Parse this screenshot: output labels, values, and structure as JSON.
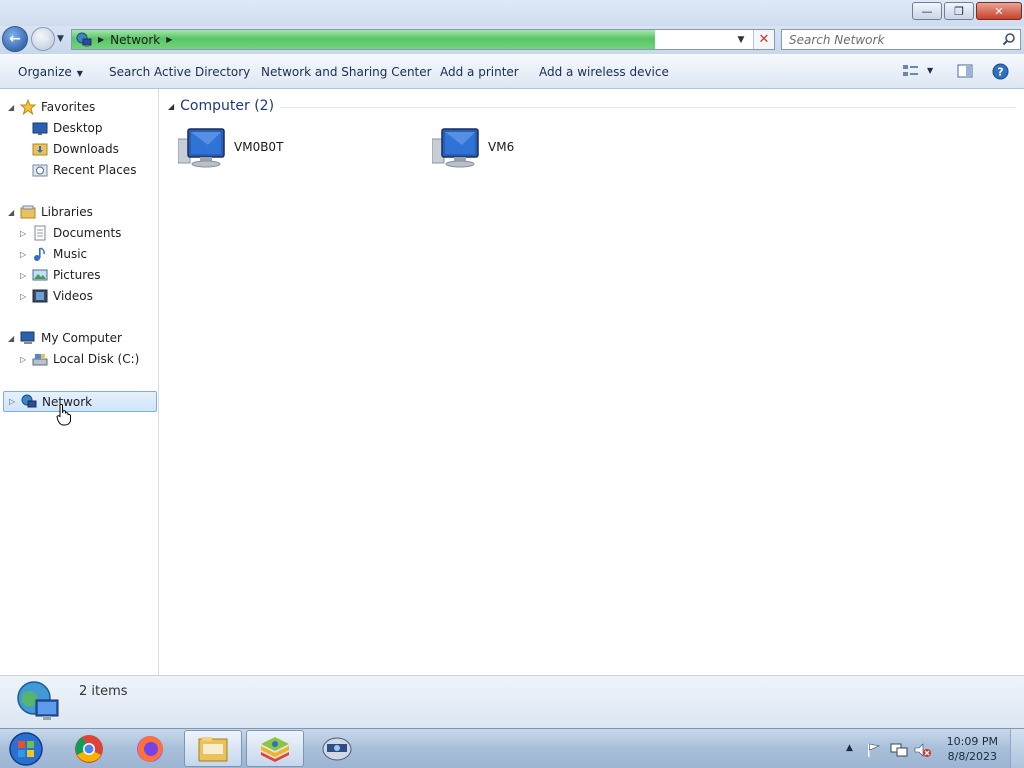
{
  "window": {
    "controls": {
      "minimize": "—",
      "maximize": "❐",
      "close": "✕"
    }
  },
  "nav": {
    "back_glyph": "←",
    "forward_glyph": "→",
    "address": {
      "location": "Network",
      "progress": 0.83
    },
    "search": {
      "placeholder": "Search Network"
    }
  },
  "toolbar": {
    "organize": "Organize",
    "search_ad": "Search Active Directory",
    "network_sharing": "Network and Sharing Center",
    "add_printer": "Add a printer",
    "add_wireless": "Add a wireless device"
  },
  "sidebar": {
    "favorites": {
      "label": "Favorites",
      "items": [
        {
          "label": "Desktop",
          "icon": "desktop-icon"
        },
        {
          "label": "Downloads",
          "icon": "downloads-folder-icon"
        },
        {
          "label": "Recent Places",
          "icon": "recent-places-icon"
        }
      ]
    },
    "libraries": {
      "label": "Libraries",
      "items": [
        {
          "label": "Documents",
          "icon": "documents-icon"
        },
        {
          "label": "Music",
          "icon": "music-icon"
        },
        {
          "label": "Pictures",
          "icon": "pictures-icon"
        },
        {
          "label": "Videos",
          "icon": "videos-icon"
        }
      ]
    },
    "computer": {
      "label": "My Computer",
      "items": [
        {
          "label": "Local Disk (C:)",
          "icon": "local-disk-icon"
        }
      ]
    },
    "network": {
      "label": "Network",
      "selected": true
    }
  },
  "content": {
    "group_header": "Computer (2)",
    "items": [
      {
        "label": "VM0B0T",
        "icon": "computer-icon"
      },
      {
        "label": "VM6",
        "icon": "computer-icon"
      }
    ]
  },
  "details": {
    "count": "2 items"
  },
  "taskbar": {
    "apps": [
      {
        "name": "Google Chrome",
        "active": false
      },
      {
        "name": "Firefox",
        "active": false
      },
      {
        "name": "Windows Explorer",
        "active": true
      },
      {
        "name": "BlueStacks",
        "active": true
      },
      {
        "name": "Network Tool",
        "active": false
      }
    ],
    "clock": {
      "time": "10:09 PM",
      "date": "8/8/2023"
    }
  },
  "colors": {
    "accent": "#1e3a7a",
    "progress": "#58c565",
    "selection": "#cfe4fb"
  }
}
